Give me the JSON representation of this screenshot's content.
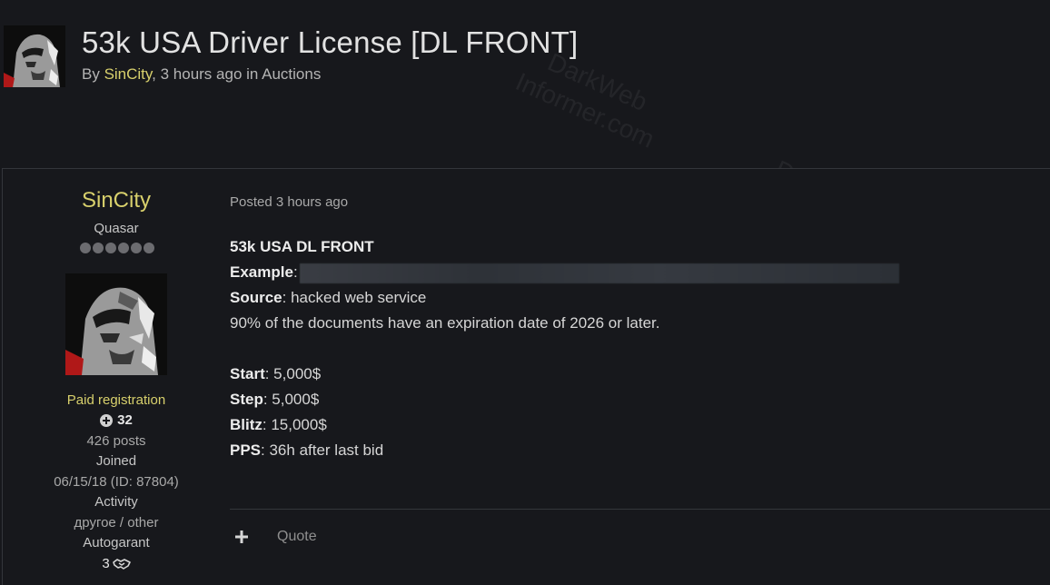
{
  "header": {
    "title": "53k USA Driver License [DL FRONT]",
    "byline_prefix": "By ",
    "author": "SinCity",
    "byline_time": ", 3 hours ago in ",
    "forum": "Auctions"
  },
  "author_panel": {
    "name": "SinCity",
    "rank": "Quasar",
    "rank_pips": 6,
    "group": "Paid registration",
    "reputation": "32",
    "posts": "426 posts",
    "joined_label": "Joined",
    "joined_value": "06/15/18 (ID: 87804)",
    "activity_label": "Activity",
    "activity_value": "другое / other",
    "autogarant_label": "Autogarant",
    "autogarant_value": "3"
  },
  "post": {
    "posted": "Posted 3 hours ago",
    "heading": "53k USA DL FRONT",
    "example_label": "Example",
    "source_label": "Source",
    "source_value": ": hacked web service",
    "note": "90% of the documents have an expiration date of 2026 or later.",
    "start_label": "Start",
    "start_value": ": 5,000$",
    "step_label": "Step",
    "step_value": ": 5,000$",
    "blitz_label": "Blitz",
    "blitz_value": ": 15,000$",
    "pps_label": "PPS",
    "pps_value": ": 36h after last bid",
    "colon": ":"
  },
  "actions": {
    "plus_icon": "plus-icon",
    "quote_label": "Quote"
  },
  "watermark": {
    "line1": "DarkWeb",
    "line2": "Informer.com"
  },
  "colors": {
    "background": "#17181c",
    "accent_yellow": "#d8d06c",
    "border": "#34363b"
  }
}
